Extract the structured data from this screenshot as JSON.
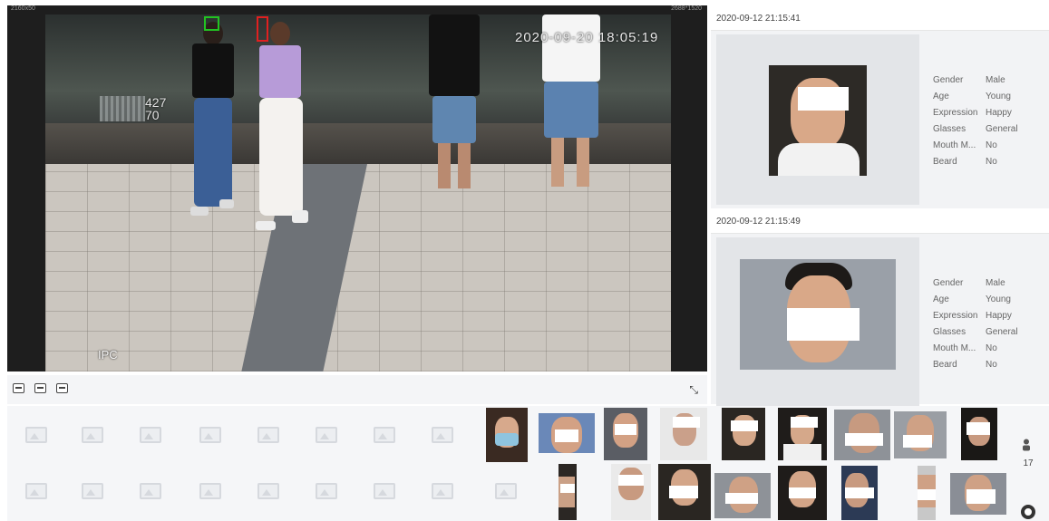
{
  "video": {
    "timestamp": "2020-09-20 18:05:19",
    "channel": "IPC",
    "count_top": "427",
    "count_bottom": "70",
    "res_left": "2160x50",
    "res_right": "2688*1520"
  },
  "toolbar": {
    "buttons": [
      "layout-1-icon",
      "layout-2-icon",
      "layout-3-icon"
    ],
    "fullscreen": "⤡"
  },
  "cards": [
    {
      "time": "2020-09-12 21:15:41",
      "attrs": [
        {
          "k": "Gender",
          "v": "Male"
        },
        {
          "k": "Age",
          "v": "Young"
        },
        {
          "k": "Expression",
          "v": "Happy"
        },
        {
          "k": "Glasses",
          "v": "General"
        },
        {
          "k": "Mouth M...",
          "v": "No"
        },
        {
          "k": "Beard",
          "v": "No"
        }
      ]
    },
    {
      "time": "2020-09-12 21:15:49",
      "attrs": [
        {
          "k": "Gender",
          "v": "Male"
        },
        {
          "k": "Age",
          "v": "Young"
        },
        {
          "k": "Expression",
          "v": "Happy"
        },
        {
          "k": "Glasses",
          "v": "General"
        },
        {
          "k": "Mouth M...",
          "v": "No"
        },
        {
          "k": "Beard",
          "v": "No"
        }
      ]
    }
  ],
  "strip": {
    "count": "17"
  },
  "colors": {
    "accent_green": "#22c322",
    "accent_red": "#e02020"
  }
}
